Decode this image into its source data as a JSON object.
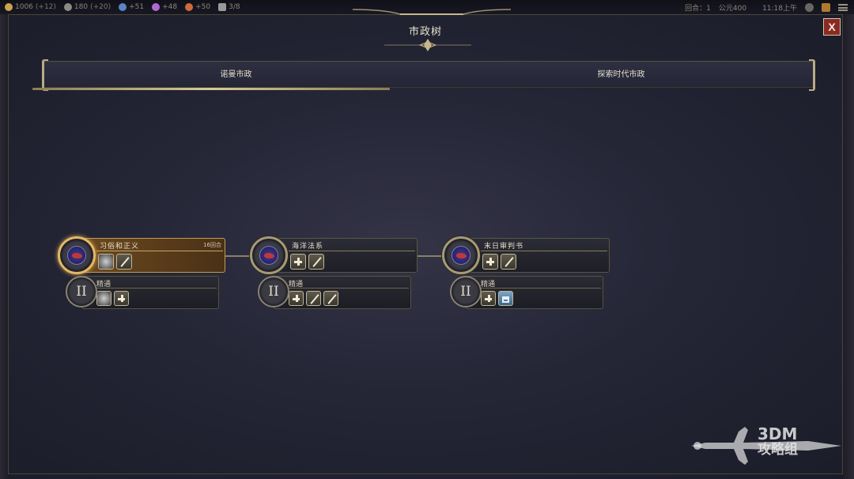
{
  "topbar": {
    "resources": [
      {
        "name": "gold",
        "value": "1006",
        "income": "(+12)",
        "color": "#c9a44a"
      },
      {
        "name": "faith",
        "value": "180",
        "income": "(+20)",
        "color": "#8c8a82"
      },
      {
        "name": "science",
        "value": "+51",
        "income": "",
        "color": "#5b84c2"
      },
      {
        "name": "culture",
        "value": "+48",
        "income": "",
        "color": "#b06ad0"
      },
      {
        "name": "tourism",
        "value": "+50",
        "income": "",
        "color": "#d06a3a"
      },
      {
        "name": "trade",
        "value": "3/8",
        "income": "",
        "color": "#9a9a9a"
      }
    ],
    "turn": "回合：1",
    "year": "公元400",
    "time": "11:18上午"
  },
  "panel": {
    "title": "市政树",
    "close_label": "X"
  },
  "tabs": [
    {
      "label": "诺曼市政",
      "selected": true
    },
    {
      "label": "探索时代市政",
      "selected": false
    }
  ],
  "civics": [
    {
      "name": "习俗和正义",
      "turns": "16回合",
      "active": true,
      "boosts": [
        "badge-icon",
        "sword-icon"
      ],
      "mastery": {
        "numeral": "II",
        "label": "精通",
        "boosts": [
          "badge-icon",
          "plus-icon"
        ]
      }
    },
    {
      "name": "海洋法系",
      "turns": "",
      "active": false,
      "boosts": [
        "plus-icon",
        "sword-icon"
      ],
      "mastery": {
        "numeral": "II",
        "label": "精通",
        "boosts": [
          "plus-icon",
          "sword-icon",
          "sword-icon"
        ]
      }
    },
    {
      "name": "末日审判书",
      "turns": "",
      "active": false,
      "boosts": [
        "plus-icon",
        "sword-icon"
      ],
      "mastery": {
        "numeral": "II",
        "label": "精通",
        "boosts": [
          "plus-icon",
          "building-icon"
        ]
      }
    }
  ],
  "watermark": {
    "line1": "3DM",
    "line2": "攻略组"
  }
}
